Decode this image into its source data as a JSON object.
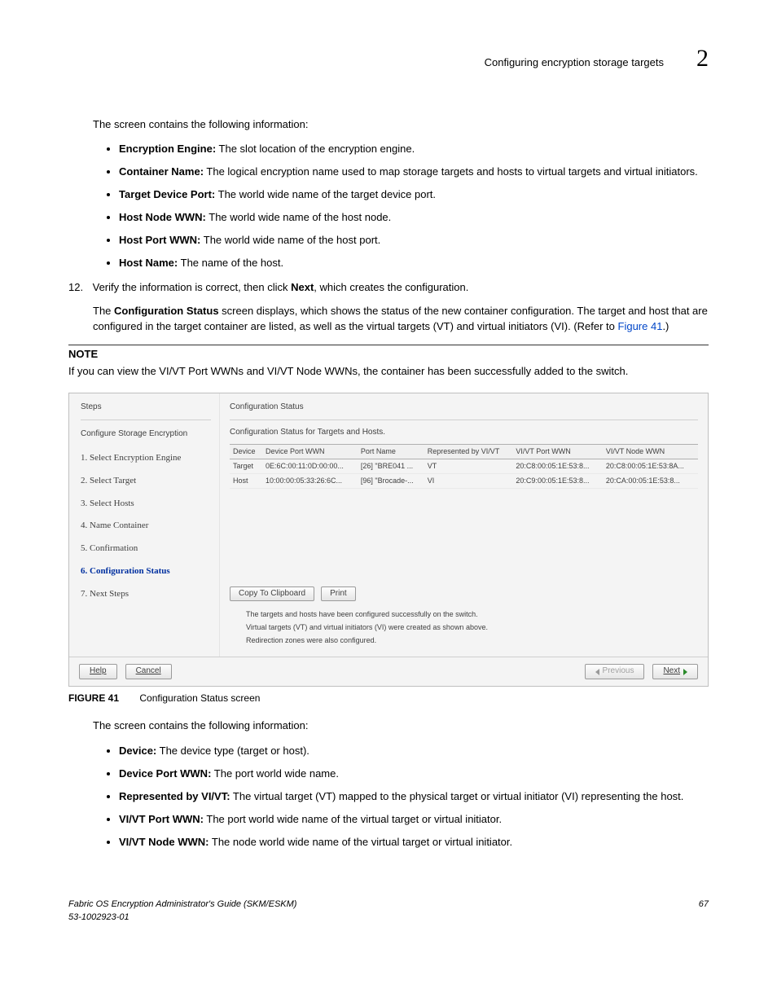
{
  "header": {
    "title": "Configuring encryption storage targets",
    "chapter": "2"
  },
  "intro1": "The screen contains the following information:",
  "bullets1": [
    {
      "term": "Encryption Engine:",
      "desc": " The slot location of the encryption engine."
    },
    {
      "term": "Container Name:",
      "desc": " The logical encryption name used to map storage targets and hosts to virtual targets and virtual initiators."
    },
    {
      "term": "Target Device Port:",
      "desc": " The world wide name of the target device port."
    },
    {
      "term": "Host Node WWN:",
      "desc": " The world wide name of the host node."
    },
    {
      "term": "Host Port WWN:",
      "desc": " The world wide name of the host port."
    },
    {
      "term": "Host Name:",
      "desc": " The name of the host."
    }
  ],
  "step12": {
    "num": "12.",
    "text_a": "Verify the information is correct, then click ",
    "text_bold": "Next",
    "text_b": ", which creates the configuration."
  },
  "config_para": {
    "a": "The ",
    "bold": "Configuration Status",
    "b": " screen displays, which shows the status of the new container configuration. The target and host that are configured in the target container are listed, as well as the virtual targets (VT) and virtual initiators (VI). (Refer to ",
    "link": "Figure 41",
    "c": ".)"
  },
  "note": {
    "heading": "NOTE",
    "text": "If you can view the VI/VT Port WWNs and VI/VT Node WWNs, the container has been successfully added to the switch."
  },
  "wizard": {
    "steps_header": "Steps",
    "wiz_title": "Configure Storage Encryption",
    "steps": [
      "1. Select Encryption Engine",
      "2. Select Target",
      "3. Select Hosts",
      "4. Name Container",
      "5. Confirmation",
      "6. Configuration Status",
      "7. Next Steps"
    ],
    "active_index": 5,
    "panel_title": "Configuration Status",
    "panel_sub": "Configuration Status for Targets and Hosts.",
    "columns": [
      "Device",
      "Device Port WWN",
      "Port Name",
      "Represented by VI/VT",
      "VI/VT Port WWN",
      "VI/VT Node WWN"
    ],
    "rows": [
      {
        "c0": "Target",
        "c1": "0E:6C:00:11:0D:00:00...",
        "c2": "[26] \"BRE041 ...",
        "c3": "VT",
        "c4": "20:C8:00:05:1E:53:8...",
        "c5": "20:C8:00:05:1E:53:8A..."
      },
      {
        "c0": "Host",
        "c1": "10:00:00:05:33:26:6C...",
        "c2": "[96] \"Brocade-...",
        "c3": "VI",
        "c4": "20:C9:00:05:1E:53:8...",
        "c5": "20:CA:00:05:1E:53:8..."
      }
    ],
    "buttons": {
      "copy": "Copy To Clipboard",
      "print": "Print"
    },
    "messages": [
      "The targets and hosts have been configured successfully on the switch.",
      "Virtual targets (VT) and virtual initiators (VI) were created as shown above.",
      "Redirection zones were also configured."
    ],
    "footer": {
      "help": "Help",
      "cancel": "Cancel",
      "prev": "Previous",
      "next": "Next"
    }
  },
  "figure": {
    "label": "FIGURE 41",
    "caption": "Configuration Status screen"
  },
  "intro2": "The screen contains the following information:",
  "bullets2": [
    {
      "term": "Device:",
      "desc": " The device type (target or host)."
    },
    {
      "term": "Device Port WWN:",
      "desc": " The port world wide name."
    },
    {
      "term": "Represented by VI/VT:",
      "desc": " The virtual target (VT) mapped to the physical target or virtual initiator (VI) representing the host."
    },
    {
      "term": "VI/VT Port WWN:",
      "desc": " The port world wide name of the virtual target or virtual initiator."
    },
    {
      "term": "VI/VT Node WWN:",
      "desc": " The node world wide name of the virtual target or virtual initiator."
    }
  ],
  "footer": {
    "line1": "Fabric OS Encryption Administrator's Guide (SKM/ESKM)",
    "line2": "53-1002923-01",
    "page": "67"
  }
}
